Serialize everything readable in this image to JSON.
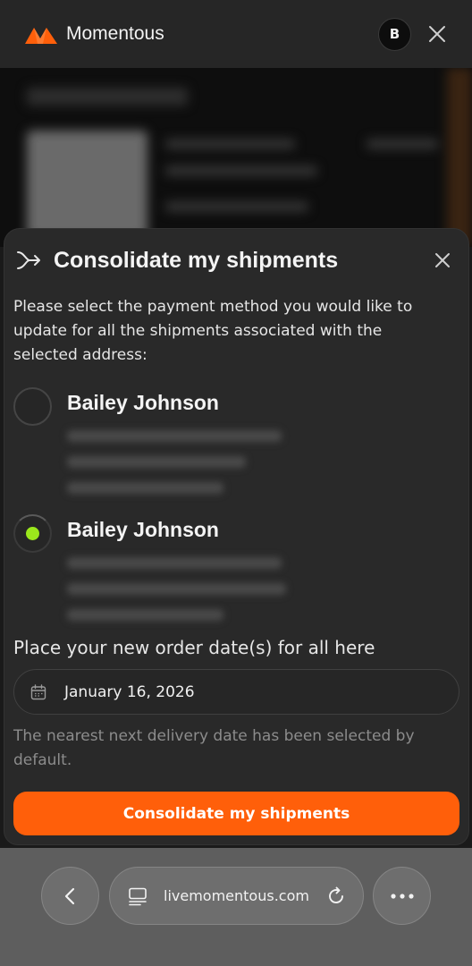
{
  "app": {
    "brand": "Momentous",
    "avatar_initial": "B",
    "logo_color": "#ff5f0a"
  },
  "modal": {
    "title": "Consolidate my shipments",
    "instruction": "Please select the payment method you would like to update for all the shipments associated with the selected address:",
    "addresses": [
      {
        "name": "Bailey Johnson",
        "selected": false
      },
      {
        "name": "Bailey Johnson",
        "selected": true
      }
    ],
    "date_label": "Place your new order date(s) for all here",
    "date_value": "January 16, 2026",
    "helper_text": "The nearest next delivery date has been selected by default.",
    "submit_label": "Consolidate my shipments",
    "accent_color": "#ff5f0a",
    "selected_radio_color": "#9be81c"
  },
  "browser": {
    "url": "livemomentous.com",
    "icons": [
      "back-icon",
      "tabs-icon",
      "reload-icon",
      "more-icon"
    ]
  }
}
